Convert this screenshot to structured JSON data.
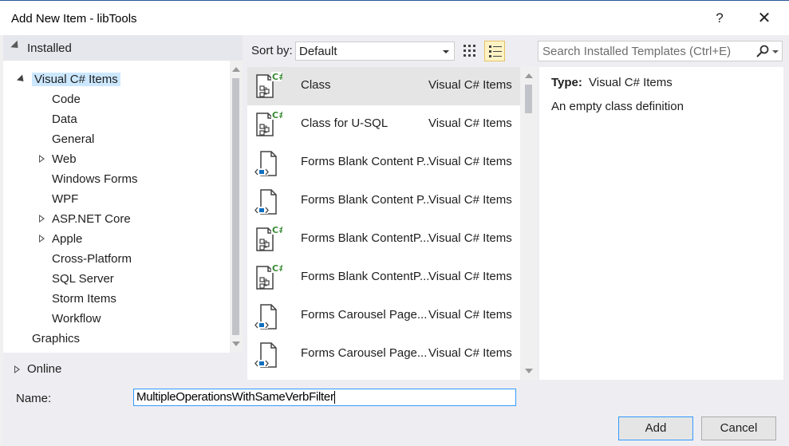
{
  "window": {
    "title": "Add New Item - libTools",
    "help_label": "?",
    "close_label": "✕"
  },
  "left_pane": {
    "installed_label": "Installed",
    "tree": [
      {
        "label": "Visual C# Items",
        "level": 0,
        "expander": "open",
        "selected": true
      },
      {
        "label": "Code",
        "level": 1,
        "expander": "none"
      },
      {
        "label": "Data",
        "level": 1,
        "expander": "none"
      },
      {
        "label": "General",
        "level": 1,
        "expander": "none"
      },
      {
        "label": "Web",
        "level": 1,
        "expander": "closed"
      },
      {
        "label": "Windows Forms",
        "level": 1,
        "expander": "none"
      },
      {
        "label": "WPF",
        "level": 1,
        "expander": "none"
      },
      {
        "label": "ASP.NET Core",
        "level": 1,
        "expander": "closed"
      },
      {
        "label": "Apple",
        "level": 1,
        "expander": "closed"
      },
      {
        "label": "Cross-Platform",
        "level": 1,
        "expander": "none"
      },
      {
        "label": "SQL Server",
        "level": 1,
        "expander": "none"
      },
      {
        "label": "Storm Items",
        "level": 1,
        "expander": "none"
      },
      {
        "label": "Workflow",
        "level": 1,
        "expander": "none"
      },
      {
        "label": "Graphics",
        "level": 0,
        "expander": "none"
      }
    ],
    "online_label": "Online"
  },
  "sort": {
    "label": "Sort by:",
    "value": "Default"
  },
  "templates": [
    {
      "name": "Class",
      "category": "Visual C# Items",
      "icon": "csharp-class-icon",
      "selected": true
    },
    {
      "name": "Class for U-SQL",
      "category": "Visual C# Items",
      "icon": "csharp-class-icon"
    },
    {
      "name": "Forms Blank Content P...",
      "category": "Visual C# Items",
      "icon": "xaml-page-icon"
    },
    {
      "name": "Forms Blank Content P...",
      "category": "Visual C# Items",
      "icon": "xaml-page-icon"
    },
    {
      "name": "Forms Blank ContentP...",
      "category": "Visual C# Items",
      "icon": "csharp-class-icon"
    },
    {
      "name": "Forms Blank ContentP...",
      "category": "Visual C# Items",
      "icon": "csharp-class-icon"
    },
    {
      "name": "Forms Carousel Page...",
      "category": "Visual C# Items",
      "icon": "xaml-page-icon"
    },
    {
      "name": "Forms Carousel Page...",
      "category": "Visual C# Items",
      "icon": "xaml-page-icon"
    },
    {
      "name": "",
      "category": "",
      "icon": "xaml-page-icon"
    }
  ],
  "search": {
    "placeholder": "Search Installed Templates (Ctrl+E)"
  },
  "details": {
    "type_label": "Type:",
    "type_value": "Visual C# Items",
    "description": "An empty class definition"
  },
  "name_field": {
    "label": "Name:",
    "value": "MultipleOperationsWithSameVerbFilter"
  },
  "buttons": {
    "add": "Add",
    "cancel": "Cancel"
  },
  "colors": {
    "accent": "#3399ff",
    "selection": "#cce8ff",
    "csharp_green": "#388a34"
  }
}
